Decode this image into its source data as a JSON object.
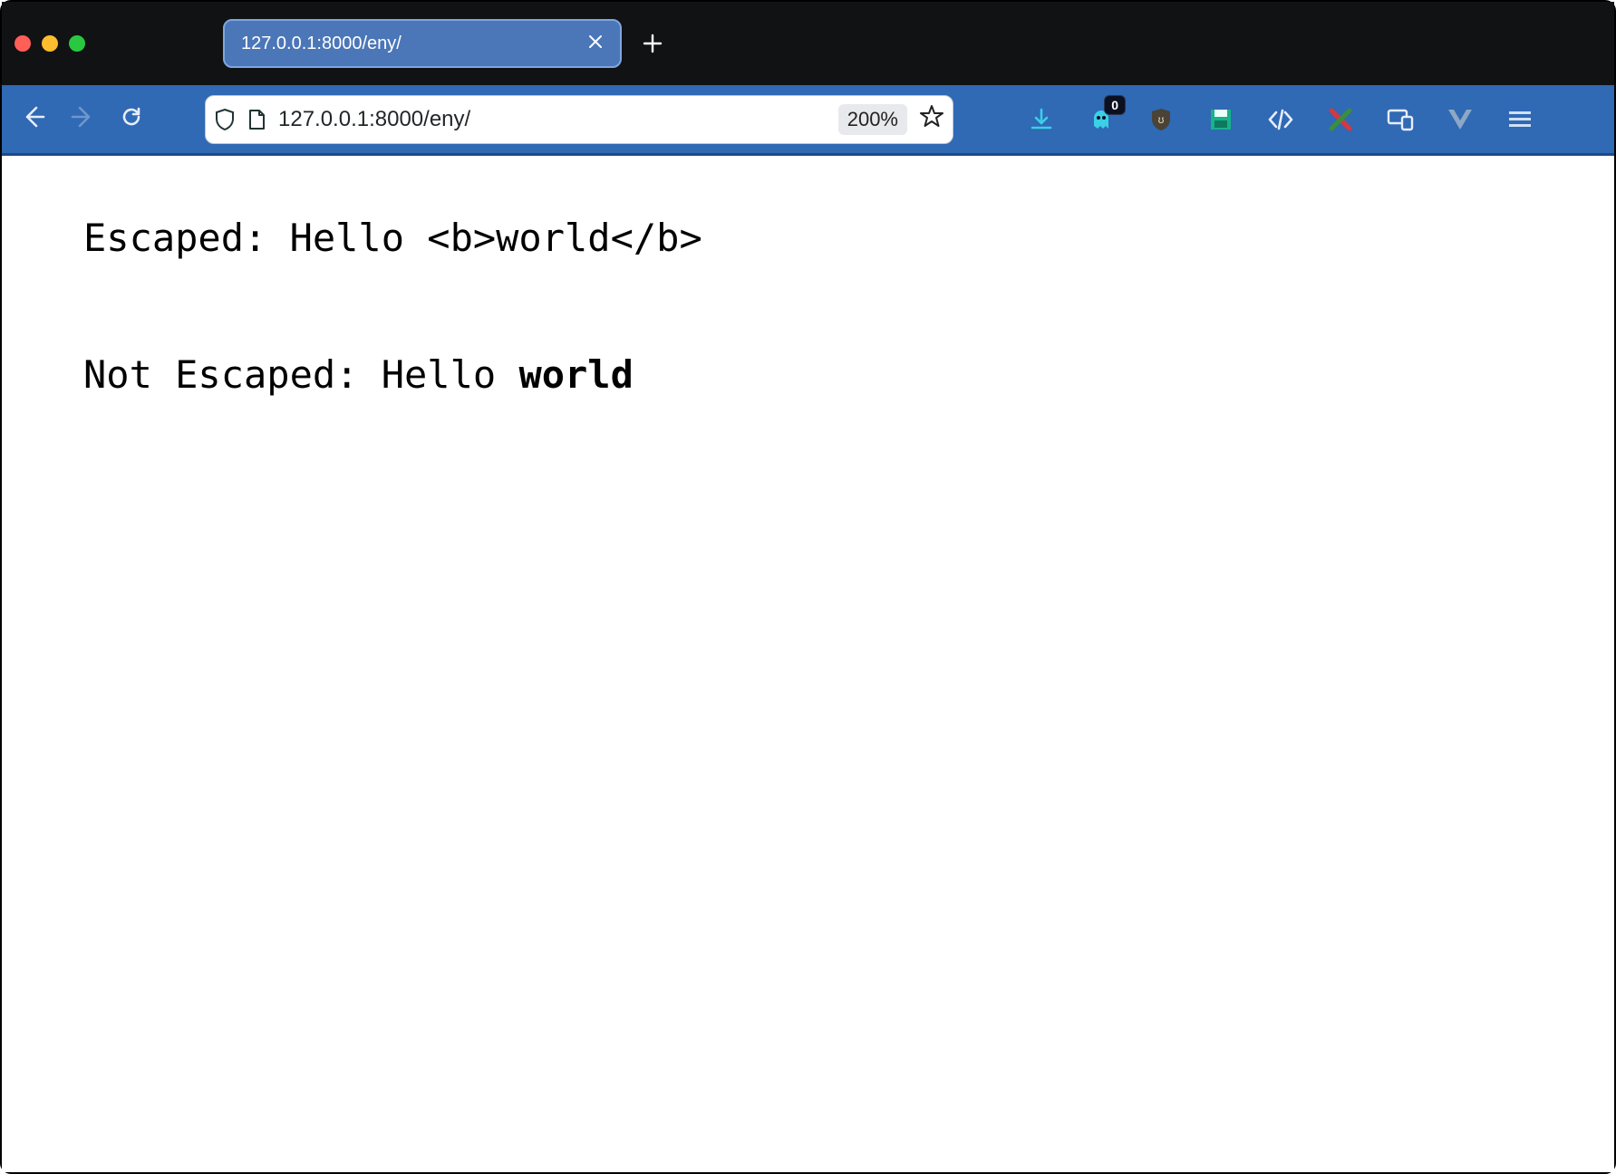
{
  "window": {
    "tab_title": "127.0.0.1:8000/eny/"
  },
  "toolbar": {
    "url": "127.0.0.1:8000/eny/",
    "zoom_label": "200%",
    "badge_count": "0"
  },
  "page": {
    "line1": "Escaped: Hello <b>world</b>",
    "line2_prefix": "Not Escaped: Hello ",
    "line2_bold": "world"
  }
}
